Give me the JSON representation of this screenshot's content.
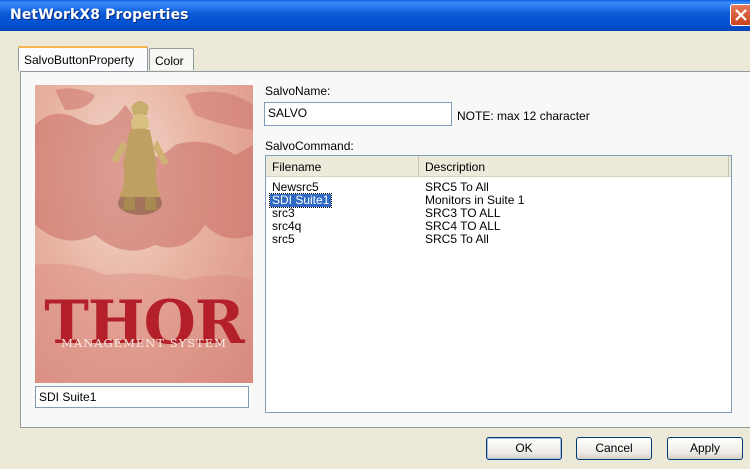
{
  "window": {
    "title": "NetWorkX8 Properties"
  },
  "tabs": [
    {
      "label": "SalvoButtonProperty",
      "active": true
    },
    {
      "label": "Color",
      "active": false
    }
  ],
  "logo": {
    "brand": "THOR",
    "tagline": "MANAGEMENT SYSTEM"
  },
  "selected_salvo_field": "SDI Suite1",
  "salvo_name": {
    "label": "SalvoName:",
    "value": "SALVO",
    "note": "NOTE: max 12 character"
  },
  "salvo_command": {
    "label": "SalvoCommand:",
    "columns": [
      "Filename",
      "Description"
    ],
    "rows": [
      {
        "filename": "Newsrc5",
        "description": "SRC5 To All",
        "selected": false
      },
      {
        "filename": "SDI Suite1",
        "description": "Monitors in Suite 1",
        "selected": true
      },
      {
        "filename": "src3",
        "description": "SRC3 TO ALL",
        "selected": false
      },
      {
        "filename": "src4q",
        "description": "SRC4 TO ALL",
        "selected": false
      },
      {
        "filename": "src5",
        "description": "SRC5 To All",
        "selected": false
      }
    ]
  },
  "buttons": {
    "ok": "OK",
    "cancel": "Cancel",
    "apply": "Apply"
  },
  "colors": {
    "titlebar": "#0a5ad6",
    "dialog_bg": "#ece9d8",
    "selection": "#316ac5",
    "logo_red": "#b3202a"
  }
}
